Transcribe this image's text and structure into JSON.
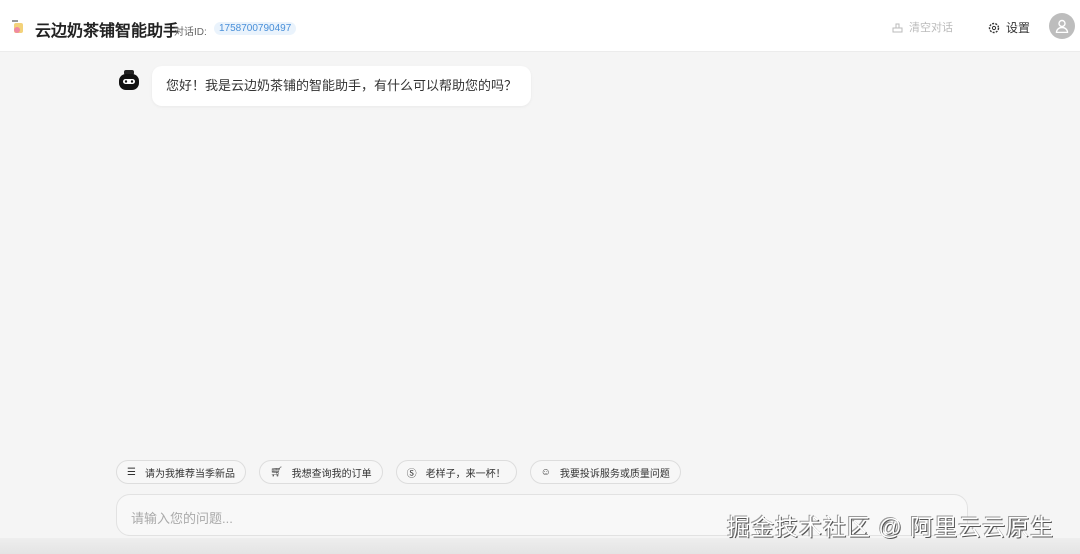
{
  "header": {
    "title": "云边奶茶铺智能助手",
    "conversation_id_label": "对话ID:",
    "conversation_id": "1758700790497",
    "clear_label": "清空对话",
    "settings_label": "设置"
  },
  "messages": [
    {
      "role": "assistant",
      "text": "您好！我是云边奶茶铺的智能助手，有什么可以帮助您的吗？"
    }
  ],
  "quick_replies": [
    {
      "icon": "menu-icon",
      "label": "请为我推荐当季新品"
    },
    {
      "icon": "cart-icon",
      "label": "我想查询我的订单"
    },
    {
      "icon": "dollar-icon",
      "label": "老样子，来一杯！"
    },
    {
      "icon": "chat-icon",
      "label": "我要投诉服务或质量问题"
    }
  ],
  "input": {
    "placeholder": "请输入您的问题..."
  },
  "watermark": "掘金技术社区 @ 阿里云云原生"
}
